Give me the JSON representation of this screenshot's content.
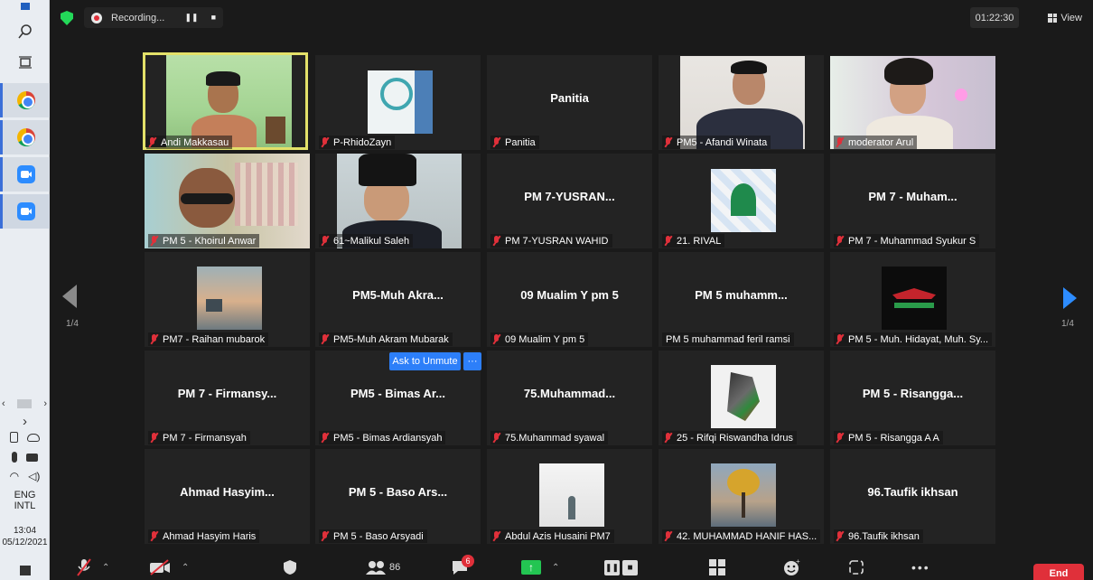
{
  "taskbar": {
    "language": "ENG",
    "layout": "INTL",
    "time": "13:04",
    "date": "05/12/2021"
  },
  "meeting": {
    "recording_label": "Recording...",
    "timer": "01:22:30",
    "view_label": "View",
    "page_left": "1/4",
    "page_right": "1/4",
    "ask_unmute_label": "Ask to Unmute",
    "more_label": "···"
  },
  "tiles": [
    {
      "big": "",
      "label": "Andi Makkasau"
    },
    {
      "big": "",
      "label": "P-RhidoZayn"
    },
    {
      "big": "Panitia",
      "label": "Panitia"
    },
    {
      "big": "",
      "label": "PM5 - Afandi Winata"
    },
    {
      "big": "",
      "label": "moderator Arul"
    },
    {
      "big": "",
      "label": "PM 5 - Khoirul Anwar"
    },
    {
      "big": "",
      "label": "61~Malikul Saleh"
    },
    {
      "big": "PM  7-YUSRAN...",
      "label": "PM 7-YUSRAN WAHID"
    },
    {
      "big": "",
      "label": "21. RIVAL"
    },
    {
      "big": "PM 7  - Muham...",
      "label": "PM 7 - Muhammad Syukur S"
    },
    {
      "big": "",
      "label": "PM7 - Raihan mubarok"
    },
    {
      "big": "PM5-Muh  Akra...",
      "label": "PM5-Muh Akram Mubarak"
    },
    {
      "big": "09 Mualim Y pm 5",
      "label": "09 Mualim Y pm 5"
    },
    {
      "big": "PM 5  muhamm...",
      "label": "PM 5 muhammad feril ramsi"
    },
    {
      "big": "",
      "label": "PM 5 - Muh. Hidayat, Muh. Sy..."
    },
    {
      "big": "PM 7  - Firmansy...",
      "label": "PM 7 - Firmansyah"
    },
    {
      "big": "PM5  - Bimas Ar...",
      "label": "PM5 - Bimas Ardiansyah"
    },
    {
      "big": "75.Muhammad...",
      "label": "75.Muhammad syawal"
    },
    {
      "big": "",
      "label": "25 - Rifqi Riswandha Idrus"
    },
    {
      "big": "PM 5  - Risangga...",
      "label": "PM 5 - Risangga A A"
    },
    {
      "big": "Ahmad  Hasyim...",
      "label": "Ahmad Hasyim Haris"
    },
    {
      "big": "PM 5  - Baso Ars...",
      "label": "PM 5 - Baso Arsyadi"
    },
    {
      "big": "",
      "label": "Abdul Azis Husaini PM7"
    },
    {
      "big": "",
      "label": "42. MUHAMMAD HANIF HAS..."
    },
    {
      "big": "96.Taufik ikhsan",
      "label": "96.Taufik ikhsan"
    }
  ],
  "toolbar": {
    "participants_count": "86",
    "chat_badge": "6",
    "end_label": "End"
  },
  "colors": {
    "accent_blue": "#2d7ff9",
    "end_red": "#e0303a",
    "speaker_yellow": "#e3e169",
    "secure_green": "#23d959"
  }
}
